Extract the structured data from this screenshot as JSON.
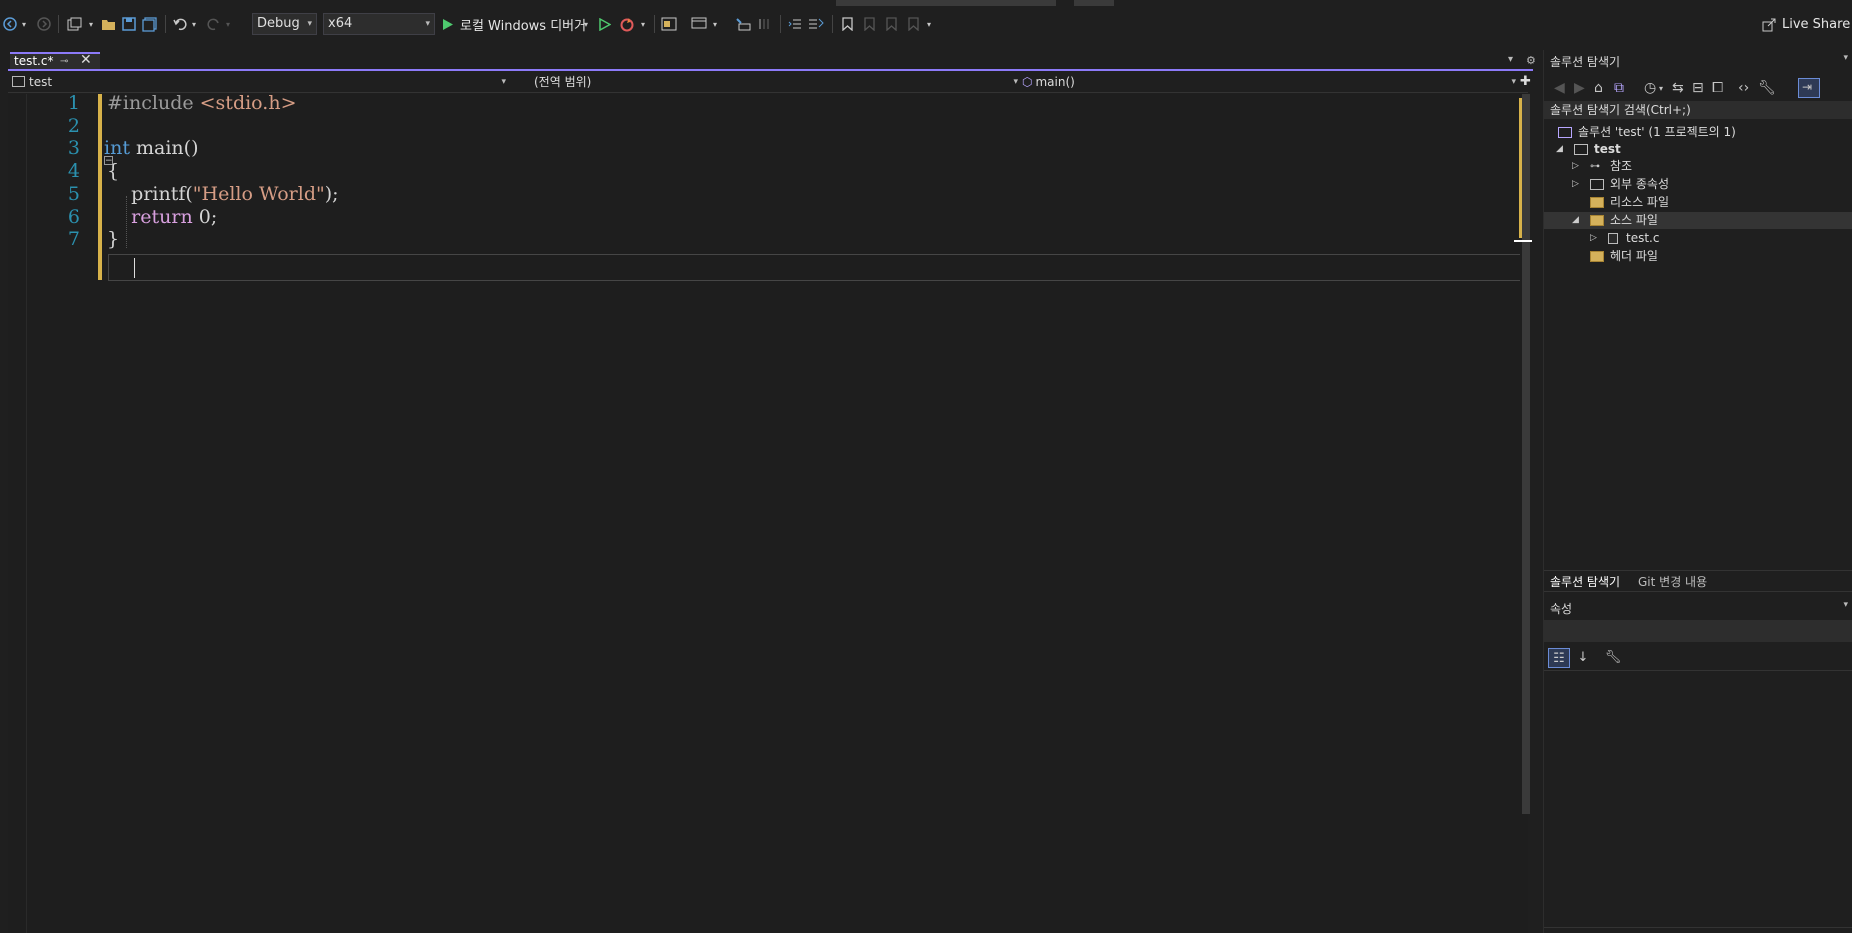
{
  "toolbar": {
    "configuration": "Debug",
    "platform": "x64",
    "run_label": "로컬 Windows 디버거",
    "live_share": "Live Share"
  },
  "editor_tab": {
    "title": "test.c*"
  },
  "nav": {
    "project": "test",
    "scope": "(전역 범위)",
    "member": "main()"
  },
  "code": {
    "line_numbers": [
      "1",
      "2",
      "3",
      "4",
      "5",
      "6",
      "7"
    ],
    "lines": [
      {
        "parts": [
          {
            "t": "#include ",
            "c": "pre"
          },
          {
            "t": "<stdio.h>",
            "c": "str"
          }
        ]
      },
      {
        "parts": []
      },
      {
        "parts": [
          {
            "t": "int",
            "c": "kw"
          },
          {
            "t": " main()",
            "c": "plain"
          }
        ]
      },
      {
        "parts": [
          {
            "t": "{",
            "c": "plain"
          }
        ]
      },
      {
        "parts": [
          {
            "t": "    printf(",
            "c": "plain"
          },
          {
            "t": "\"Hello World\"",
            "c": "str"
          },
          {
            "t": ");",
            "c": "plain"
          }
        ]
      },
      {
        "parts": [
          {
            "t": "    ",
            "c": "plain"
          },
          {
            "t": "return",
            "c": "ctl"
          },
          {
            "t": " 0;",
            "c": "plain"
          }
        ]
      },
      {
        "parts": [
          {
            "t": "}",
            "c": "plain"
          }
        ]
      }
    ]
  },
  "solution_explorer": {
    "title": "솔루션 탐색기",
    "search_placeholder": "솔루션 탐색기 검색(Ctrl+;)",
    "solution": "솔루션 'test' (1 프로젝트의 1)",
    "project": "test",
    "items": {
      "references": "참조",
      "external_deps": "외부 종속성",
      "resource_files": "리소스 파일",
      "source_files": "소스 파일",
      "source_file_testc": "test.c",
      "header_files": "헤더 파일"
    },
    "tabs": {
      "explorer": "솔루션 탐색기",
      "git": "Git 변경 내용"
    }
  },
  "properties": {
    "title": "속성"
  },
  "colors": {
    "accent": "#8c7af8",
    "line_number": "#2b91af",
    "keyword": "#569cd6",
    "control_keyword": "#d8a0df",
    "string": "#d69d85",
    "change_marker": "#d7b24a"
  }
}
